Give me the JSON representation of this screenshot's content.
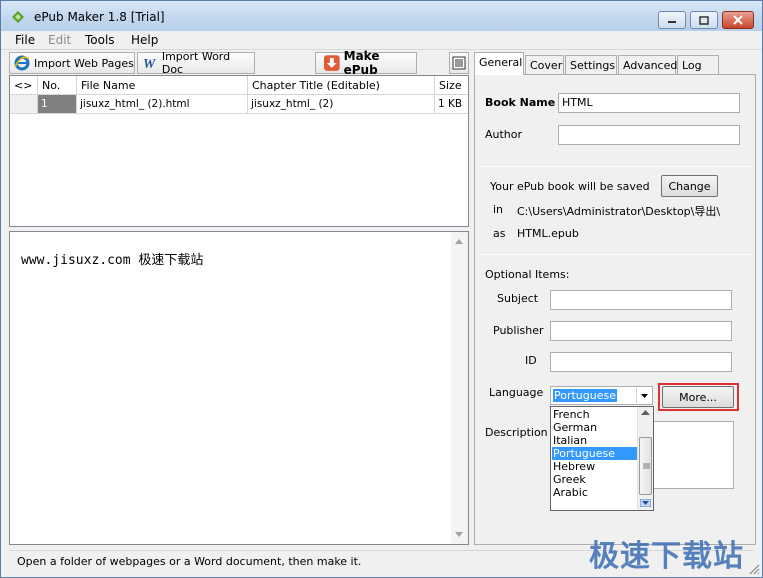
{
  "window": {
    "title": "ePub Maker 1.8 [Trial]"
  },
  "menu": {
    "file": "File",
    "edit": "Edit",
    "tools": "Tools",
    "help": "Help"
  },
  "toolbar": {
    "import_web": "Import Web Pages",
    "import_word": "Import Word Doc",
    "make_epub": "Make ePub"
  },
  "table": {
    "headers": {
      "order": "<>",
      "no": "No.",
      "file": "File Name",
      "chapter": "Chapter Title (Editable)",
      "size": "Size"
    },
    "rows": [
      {
        "no": "1",
        "file": "jisuxz_html_ (2).html",
        "chapter": "jisuxz_html_ (2)",
        "size": "1 KB"
      }
    ]
  },
  "preview": {
    "text": "www.jisuxz.com 极速下载站"
  },
  "status": {
    "text": "Open a folder of webpages or a Word document, then make it."
  },
  "tabs": {
    "general": "General",
    "cover": "Cover",
    "settings": "Settings",
    "advanced": "Advanced",
    "log": "Log"
  },
  "general": {
    "book_name_label": "Book Name",
    "book_name_value": "HTML",
    "author_label": "Author",
    "author_value": "",
    "saved_label": "Your ePub book will be saved",
    "change_label": "Change",
    "in_label": "in",
    "path_value": "C:\\Users\\Administrator\\Desktop\\导出\\",
    "as_label": "as",
    "filename_value": "HTML.epub",
    "optional_label": "Optional Items:",
    "subject_label": "Subject",
    "publisher_label": "Publisher",
    "id_label": "ID",
    "language_label": "Language",
    "language_value": "Portuguese",
    "more_label": "More...",
    "description_label": "Description",
    "language_options": [
      "French",
      "German",
      "Italian",
      "Portuguese",
      "Hebrew",
      "Greek",
      "Arabic"
    ]
  },
  "watermark": {
    "text": "极速下载站"
  },
  "colors": {
    "accent": "#3399ff",
    "highlight": "#e03131",
    "titlebar": "#c4d8ef"
  }
}
